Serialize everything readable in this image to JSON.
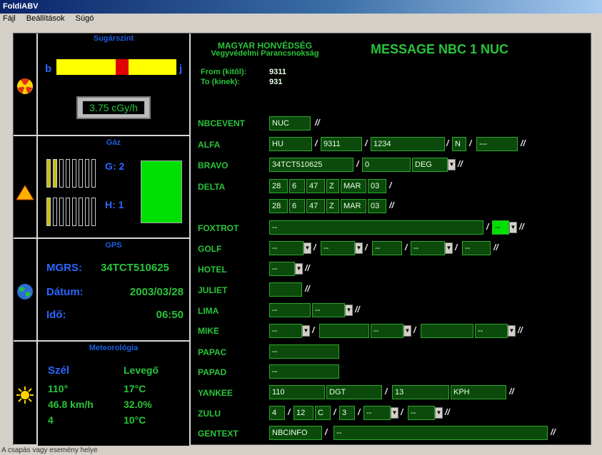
{
  "app": {
    "title": "FoldiABV"
  },
  "menu": [
    "Fájl",
    "Beállítások",
    "Súgó"
  ],
  "status": "A csapás vagy esemény helye",
  "sugarszint": {
    "title": "Sugárszint",
    "left": "b",
    "right": "j",
    "value": "3.75 cGy/h",
    "level": 0.55
  },
  "gaz": {
    "title": "Gáz",
    "g_label": "G: 2",
    "h_label": "H: 1",
    "g": 2,
    "h": 1
  },
  "gps": {
    "title": "GPS",
    "mgrs_label": "MGRS:",
    "mgrs": "34TCT510625",
    "datum_label": "Dátum:",
    "datum": "2003/03/28",
    "ido_label": "Idő:",
    "ido": "06:50"
  },
  "meteo": {
    "title": "Meteorológia",
    "szel": "Szél",
    "levego": "Levegő",
    "r1a": "110°",
    "r1b": "17°C",
    "r2a": "46.8 km/h",
    "r2b": "32.0%",
    "r3a": "4",
    "r3b": "10°C"
  },
  "header": {
    "org1": "MAGYAR HONVÉDSÉG",
    "org2": "Vegyvédelmi Parancsnokság",
    "msg": "MESSAGE NBC 1 NUC",
    "from_label": "From (kitől):",
    "from": "9311",
    "to_label": "To (kinek):",
    "to": "931"
  },
  "form": {
    "labels": [
      "NBCEVENT",
      "ALFA",
      "BRAVO",
      "DELTA",
      "FOXTROT",
      "GOLF",
      "HOTEL",
      "JULIET",
      "LIMA",
      "MIKE",
      "PAPAC",
      "PAPAD",
      "YANKEE",
      "ZULU",
      "GENTEXT"
    ],
    "nbcevent": "NUC",
    "alfa": [
      "HU",
      "9311",
      "1234",
      "N",
      "---"
    ],
    "bravo": [
      "34TCT510625",
      "0",
      "DEG"
    ],
    "delta1": [
      "28",
      "6",
      "47",
      "Z",
      "MAR",
      "03"
    ],
    "delta2": [
      "28",
      "6",
      "47",
      "Z",
      "MAR",
      "03"
    ],
    "foxtrot": [
      "--",
      "--"
    ],
    "golf": [
      "--",
      "--",
      "--",
      "--",
      "--"
    ],
    "hotel": "--",
    "juliet": "",
    "lima": [
      "--",
      "--"
    ],
    "mike": [
      "--",
      "",
      "--",
      "",
      "--"
    ],
    "papac": "--",
    "papad": "--",
    "yankee": [
      "110",
      "DGT",
      "13",
      "KPH"
    ],
    "zulu": [
      "4",
      "12",
      "C",
      "3",
      "--",
      "--"
    ],
    "gentext": [
      "NBCINFO",
      "--"
    ]
  }
}
